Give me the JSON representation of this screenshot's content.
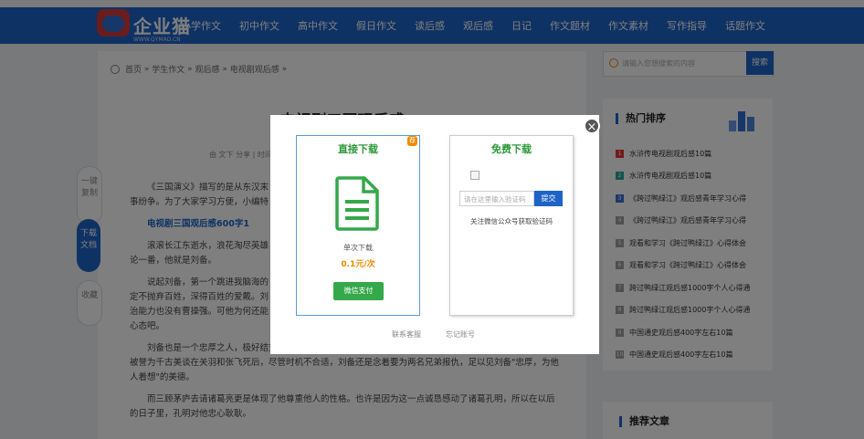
{
  "header": {
    "logo_text": "企业猫",
    "logo_url_text": "WWW.QYMAO.CN",
    "nav": [
      "小学作文",
      "初中作文",
      "高中作文",
      "假日作文",
      "读后感",
      "观后感",
      "日记",
      "作文题材",
      "作文素材",
      "写作指导",
      "话题作文"
    ]
  },
  "breadcrumb": [
    "首页",
    "学生作文",
    "观后感",
    "电视剧观后感"
  ],
  "article": {
    "title": "电视剧三国观后感",
    "meta": "由 文下 分享 | 时间",
    "paragraphs": [
      "《三国演义》描写的是从东汉末",
      "事纷争。为了大家学习方便，小编特",
      "滚滚长江东逝水，浪花淘尽英雄",
      "论一番，他就是刘备。",
      "说起刘备，第一个跳进我脑海的",
      "定不抛弃百姓，深得百姓的爱戴。刘",
      "治能力也没有曹操强。可他为何还能",
      "心态吧。",
      "刘备也是一个忠厚之人，极好结交英雄豪杰。书中第一回讲述的是\"刘关张桃园三结义，生死之交\".这次结义被誉为千古美谈在关羽和张飞死后，尽管时机不合适，刘备还是念着要为两名兄弟报仇，足以见刘备\"忠厚，为他人着想\"的美德。",
      "而三顾茅庐去请诸葛亮更是体现了他尊重他人的性格。也许是因为这一点诚恳感动了诸葛孔明，所以在以后的日子里，孔明对他忠心耿耿。"
    ],
    "subheading": "电视剧三国观后感600字1"
  },
  "side_buttons": [
    "一键复制",
    "下载文档",
    "收藏"
  ],
  "search": {
    "placeholder": "请输入您想搜索的内容",
    "button": "搜索"
  },
  "hot_rank": {
    "title": "热门排序",
    "items": [
      {
        "num": "1",
        "text": "水浒传电视剧观后感10篇",
        "color": "#e53935"
      },
      {
        "num": "2",
        "text": "水浒传电视剧观后感10篇",
        "color": "#26a69a"
      },
      {
        "num": "3",
        "text": "《跨过鸭绿江》观后感青年学习心得",
        "color": "#3f6fd8"
      },
      {
        "num": "4",
        "text": "《跨过鸭绿江》观后感青年学习心得",
        "color": "#9e9e9e"
      },
      {
        "num": "5",
        "text": "观看和学习《跨过鸭绿江》心得体会",
        "color": "#9e9e9e"
      },
      {
        "num": "6",
        "text": "观看和学习《跨过鸭绿江》心得体会",
        "color": "#9e9e9e"
      },
      {
        "num": "7",
        "text": "跨过鸭绿江观后感1000字个人心得通",
        "color": "#9e9e9e"
      },
      {
        "num": "8",
        "text": "跨过鸭绿江观后感1000字个人心得通",
        "color": "#9e9e9e"
      },
      {
        "num": "9",
        "text": "中国通史观后感400字左右10篇",
        "color": "#9e9e9e"
      },
      {
        "num": "10",
        "text": "中国通史观后感400字左右10篇",
        "color": "#9e9e9e"
      }
    ]
  },
  "recommend": {
    "title": "推荐文章"
  },
  "modal": {
    "close_glyph": "×",
    "direct": {
      "title": "直接下载",
      "tag": "荐",
      "once_label": "单次下载",
      "price": "0.1元/次",
      "pay_button": "微信支付"
    },
    "free": {
      "title": "免费下载",
      "code_placeholder": "请在这里输入验证码",
      "submit": "提交",
      "hint": "关注微信公众号获取验证码"
    },
    "links": [
      "联系客服",
      "忘记账号"
    ]
  }
}
